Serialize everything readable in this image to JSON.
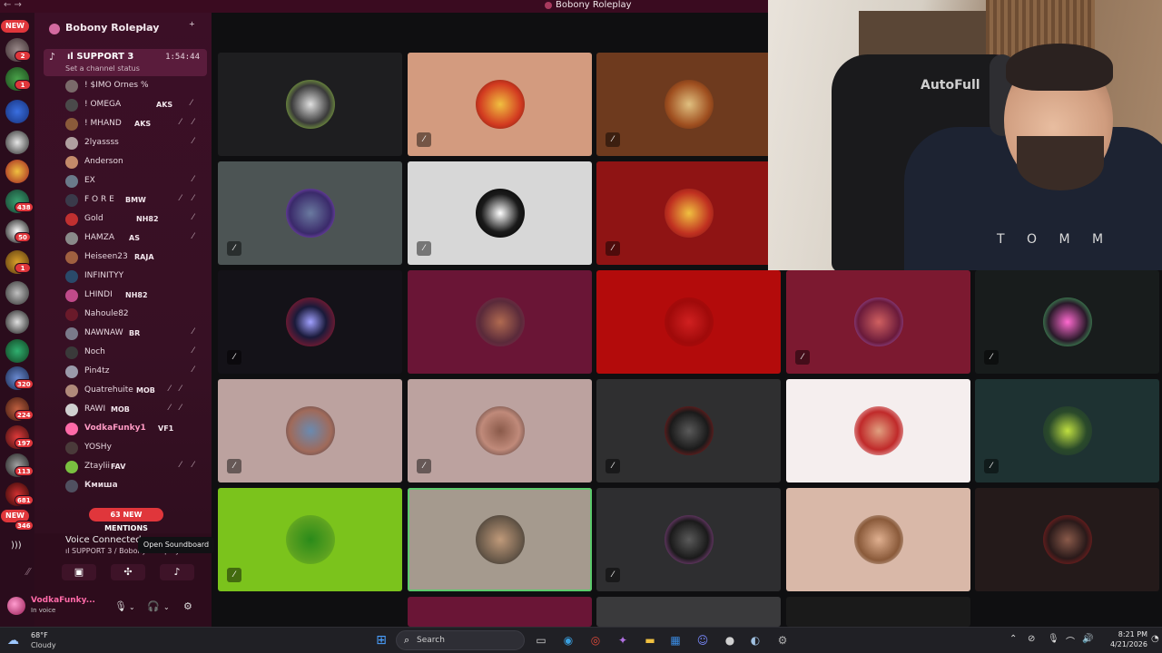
{
  "window": {
    "title": "Bobony Roleplay",
    "back_arrows": "← →"
  },
  "rail": {
    "new_top": "NEW",
    "new_bottom": "NEW",
    "counts": [
      "2",
      "1",
      "438",
      "50",
      "1",
      "320",
      "224",
      "197",
      "113",
      "681",
      "346"
    ]
  },
  "server": {
    "name": "Bobony Roleplay"
  },
  "channel": {
    "name": "ıl SUPPORT 3",
    "time": "1:54:44",
    "status": "Set a channel status"
  },
  "users": [
    {
      "name": "! $IMO Ornes %",
      "tag": ""
    },
    {
      "name": "! OMEGA",
      "tag": "AKS"
    },
    {
      "name": "! MHAND",
      "tag": "AKS"
    },
    {
      "name": "2lyassss",
      "tag": ""
    },
    {
      "name": "Anderson",
      "tag": ""
    },
    {
      "name": "EX",
      "tag": ""
    },
    {
      "name": "F O R E",
      "tag": "BMW"
    },
    {
      "name": "Gold",
      "tag": "NH82"
    },
    {
      "name": "HAMZA",
      "tag": "AS"
    },
    {
      "name": "Heiseen23",
      "tag": "RAJA"
    },
    {
      "name": "INFINITYY",
      "tag": ""
    },
    {
      "name": "LHINDI",
      "tag": "NH82"
    },
    {
      "name": "Nahoule82",
      "tag": ""
    },
    {
      "name": "NAWNAW",
      "tag": "BR"
    },
    {
      "name": "Noch",
      "tag": ""
    },
    {
      "name": "Pin4tz",
      "tag": ""
    },
    {
      "name": "Quatrehuite",
      "tag": "MOB"
    },
    {
      "name": "RAWI",
      "tag": "MOB"
    },
    {
      "name": "VodkaFunky1",
      "tag": "VF1"
    },
    {
      "name": "YOSHy",
      "tag": ""
    },
    {
      "name": "Ztaylii",
      "tag": "FAV"
    },
    {
      "name": "Кмиша",
      "tag": ""
    }
  ],
  "mentions": "63 NEW MENTIONS",
  "voice": {
    "title": "Voice Connected",
    "subtitle": "ıl SUPPORT 3 / Bobony Roleplay"
  },
  "tooltip": "Open Soundboard",
  "me": {
    "name": "VodkaFunky...",
    "status": "In voice"
  },
  "webcam": {
    "chair_logo": "AutoFull",
    "shirt_text": "T O M M"
  },
  "taskbar": {
    "weather_temp": "68°F",
    "weather_desc": "Cloudy",
    "search_placeholder": "Search",
    "time": "8:21 PM",
    "date": "4/21/2026"
  }
}
